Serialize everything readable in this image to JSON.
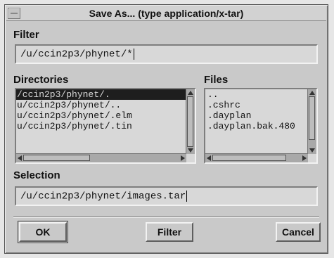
{
  "window": {
    "title": "Save As... (type application/x-tar)"
  },
  "filter": {
    "label": "Filter",
    "value": "/u/ccin2p3/phynet/*"
  },
  "directories": {
    "label": "Directories",
    "items": [
      "/ccin2p3/phynet/.",
      "u/ccin2p3/phynet/..",
      "u/ccin2p3/phynet/.elm",
      "u/ccin2p3/phynet/.tin"
    ],
    "selected_index": 0
  },
  "files": {
    "label": "Files",
    "items": [
      "..",
      ".cshrc",
      ".dayplan",
      ".dayplan.bak.480"
    ]
  },
  "selection": {
    "label": "Selection",
    "value": "/u/ccin2p3/phynet/images.tar"
  },
  "buttons": {
    "ok": "OK",
    "filter": "Filter",
    "cancel": "Cancel"
  }
}
